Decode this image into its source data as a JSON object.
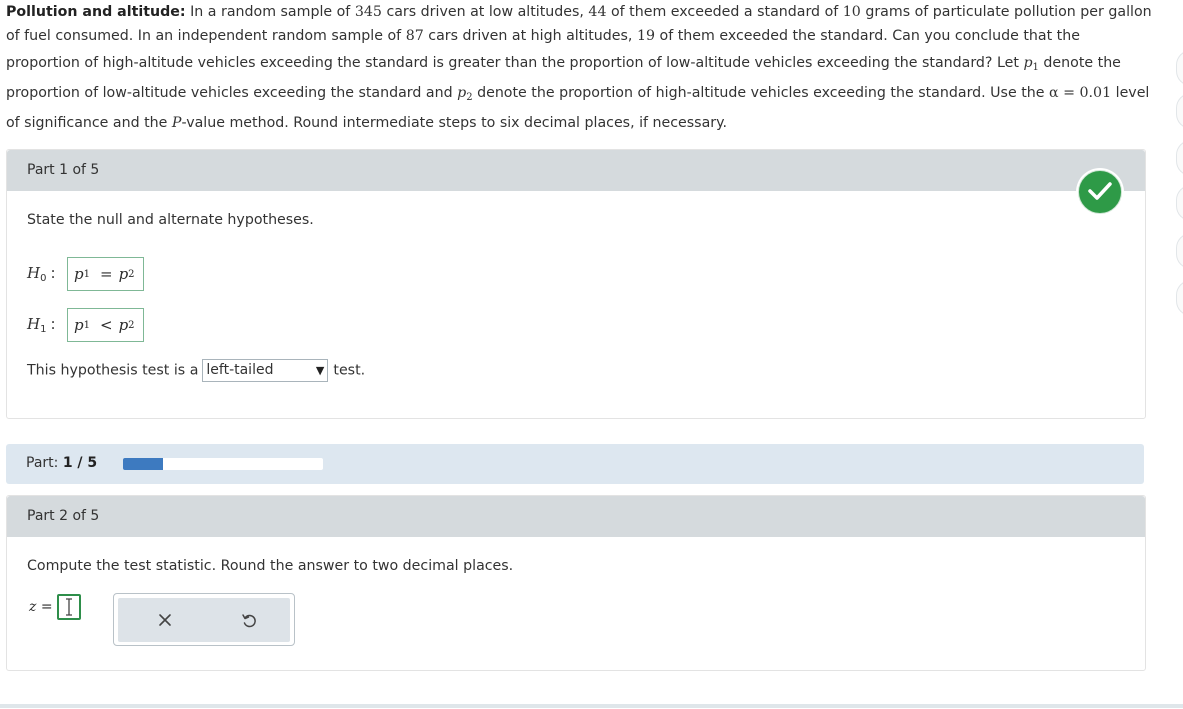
{
  "problem": {
    "title": "Pollution and altitude:",
    "line1_a": "In a random sample of",
    "n_low": "345",
    "line1_b": "cars driven at low altitudes,",
    "x_low": "44",
    "line1_c": "of them exceeded a standard of",
    "standard": "10",
    "line1_d": "grams of particulate pollution per gallon",
    "line2_a": "of fuel consumed. In an independent random sample of",
    "n_high": "87",
    "line2_b": "cars driven at high altitudes,",
    "x_high": "19",
    "line2_c": "of them exceeded the standard. Can you conclude that the",
    "line3": "proportion of high-altitude vehicles exceeding the standard is greater than the proportion of low-altitude vehicles exceeding the standard? Let",
    "line3_end": "denote the",
    "line4_a": "proportion of low-altitude vehicles exceeding the standard and",
    "line4_b": "denote the proportion of high-altitude vehicles exceeding the standard. Use the",
    "alpha_sym": "α",
    "alpha_val": "= 0.01",
    "line4_c": "level",
    "line5_a": "of significance and the",
    "p_symbol": "P",
    "line5_b": "-value method. Round intermediate steps to six decimal places, if necessary."
  },
  "part1": {
    "header": "Part 1 of 5",
    "prompt": "State the null and alternate hypotheses.",
    "h0": {
      "label": "H",
      "sub": "0",
      "lhs": "p",
      "lhs_sub": "1",
      "op": "=",
      "rhs": "p",
      "rhs_sub": "2"
    },
    "h1": {
      "label": "H",
      "sub": "1",
      "lhs": "p",
      "lhs_sub": "1",
      "op": "<",
      "rhs": "p",
      "rhs_sub": "2"
    },
    "tail_pre": "This hypothesis test is a",
    "tail_selected": "left-tailed",
    "tail_post": "test.",
    "status_icon": "checkmark-icon",
    "status_color": "#2e9a47"
  },
  "progress": {
    "label": "Part:",
    "value": "1 / 5",
    "fraction": 0.2,
    "color": "#3d7ac0"
  },
  "part2": {
    "header": "Part 2 of 5",
    "prompt": "Compute the test statistic. Round the answer to two decimal places.",
    "z_label": "z =",
    "answer_value": "",
    "tools": [
      "clear-icon",
      "undo-icon"
    ]
  }
}
